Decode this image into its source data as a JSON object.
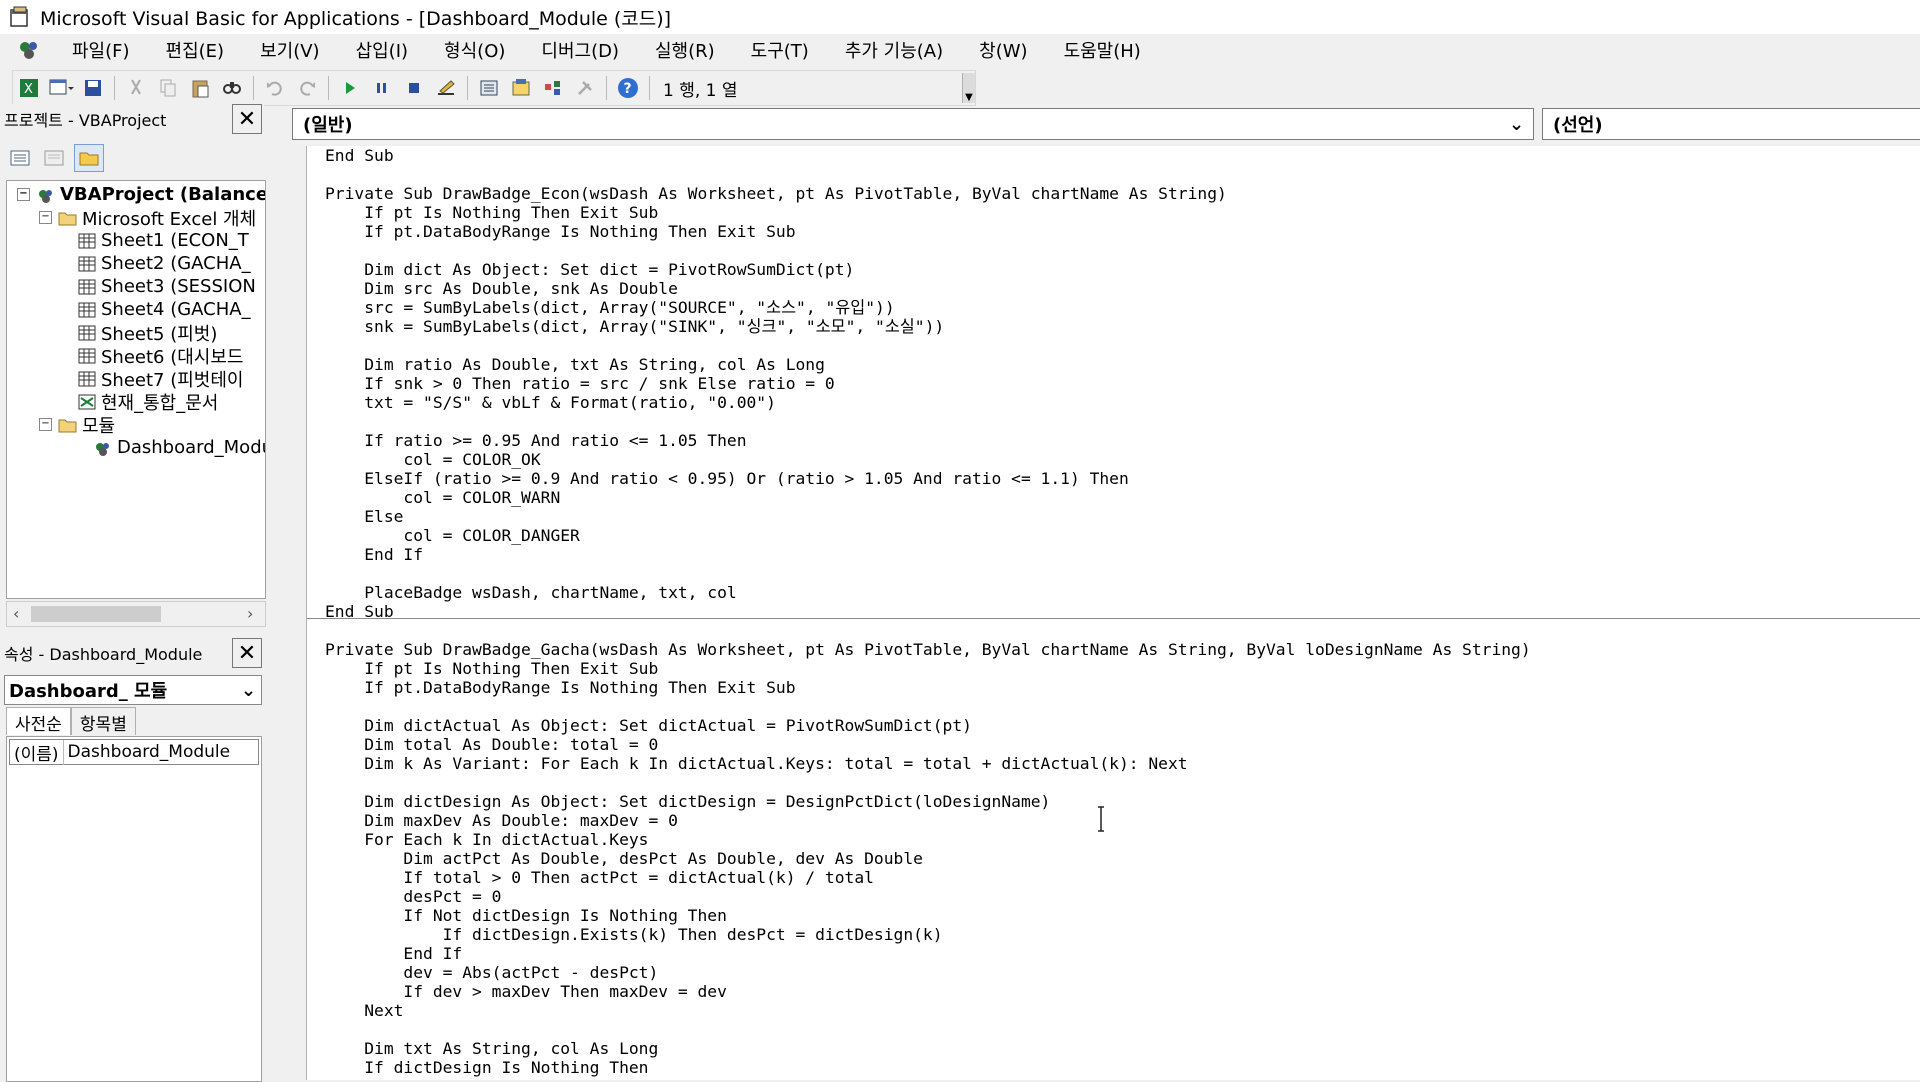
{
  "window": {
    "title": "Microsoft Visual Basic for Applications - [Dashboard_Module (코드)]"
  },
  "menu": [
    "파일(F)",
    "편집(E)",
    "보기(V)",
    "삽입(I)",
    "형식(O)",
    "디버그(D)",
    "실행(R)",
    "도구(T)",
    "추가 기능(A)",
    "창(W)",
    "도움말(H)"
  ],
  "toolbar": {
    "position_label": "1 행, 1 열",
    "icons": [
      "excel-view-icon",
      "insert-userform-icon",
      "save-icon",
      "cut-icon",
      "copy-icon",
      "paste-icon",
      "find-icon",
      "undo-icon",
      "redo-icon",
      "run-icon",
      "break-icon",
      "reset-icon",
      "design-mode-icon",
      "project-explorer-icon",
      "properties-icon",
      "object-browser-icon",
      "toolbox-icon",
      "help-icon"
    ]
  },
  "project_pane": {
    "title": "프로젝트 - VBAProject",
    "tree": {
      "root": "VBAProject (Balance",
      "excel_objects_folder": "Microsoft Excel 개체",
      "sheets": [
        "Sheet1 (ECON_T",
        "Sheet2 (GACHA_",
        "Sheet3 (SESSION",
        "Sheet4 (GACHA_",
        "Sheet5 (피벗)",
        "Sheet6 (대시보드",
        "Sheet7 (피벗테이"
      ],
      "workbook": "현재_통합_문서",
      "modules_folder": "모듈",
      "module": "Dashboard_Modu"
    }
  },
  "properties_pane": {
    "title": "속성 - Dashboard_Module",
    "object_dropdown": "Dashboard_ 모듈",
    "tabs": [
      "사전순",
      "항목별"
    ],
    "rows": [
      {
        "key": "(이름)",
        "value": "Dashboard_Module"
      }
    ]
  },
  "code_window": {
    "object_dropdown": "(일반)",
    "proc_dropdown": "(선언)",
    "lines": [
      "End Sub",
      "",
      "Private Sub DrawBadge_Econ(wsDash As Worksheet, pt As PivotTable, ByVal chartName As String)",
      "    If pt Is Nothing Then Exit Sub",
      "    If pt.DataBodyRange Is Nothing Then Exit Sub",
      "",
      "    Dim dict As Object: Set dict = PivotRowSumDict(pt)",
      "    Dim src As Double, snk As Double",
      "    src = SumByLabels(dict, Array(\"SOURCE\", \"소스\", \"유입\"))",
      "    snk = SumByLabels(dict, Array(\"SINK\", \"싱크\", \"소모\", \"소실\"))",
      "",
      "    Dim ratio As Double, txt As String, col As Long",
      "    If snk > 0 Then ratio = src / snk Else ratio = 0",
      "    txt = \"S/S\" & vbLf & Format(ratio, \"0.00\")",
      "",
      "    If ratio >= 0.95 And ratio <= 1.05 Then",
      "        col = COLOR_OK",
      "    ElseIf (ratio >= 0.9 And ratio < 0.95) Or (ratio > 1.05 And ratio <= 1.1) Then",
      "        col = COLOR_WARN",
      "    Else",
      "        col = COLOR_DANGER",
      "    End If",
      "",
      "    PlaceBadge wsDash, chartName, txt, col",
      "End Sub",
      "",
      "Private Sub DrawBadge_Gacha(wsDash As Worksheet, pt As PivotTable, ByVal chartName As String, ByVal loDesignName As String)",
      "    If pt Is Nothing Then Exit Sub",
      "    If pt.DataBodyRange Is Nothing Then Exit Sub",
      "",
      "    Dim dictActual As Object: Set dictActual = PivotRowSumDict(pt)",
      "    Dim total As Double: total = 0",
      "    Dim k As Variant: For Each k In dictActual.Keys: total = total + dictActual(k): Next",
      "",
      "    Dim dictDesign As Object: Set dictDesign = DesignPctDict(loDesignName)",
      "    Dim maxDev As Double: maxDev = 0",
      "    For Each k In dictActual.Keys",
      "        Dim actPct As Double, desPct As Double, dev As Double",
      "        If total > 0 Then actPct = dictActual(k) / total",
      "        desPct = 0",
      "        If Not dictDesign Is Nothing Then",
      "            If dictDesign.Exists(k) Then desPct = dictDesign(k)",
      "        End If",
      "        dev = Abs(actPct - desPct)",
      "        If dev > maxDev Then maxDev = dev",
      "    Next",
      "",
      "    Dim txt As String, col As Long",
      "    If dictDesign Is Nothing Then"
    ]
  }
}
